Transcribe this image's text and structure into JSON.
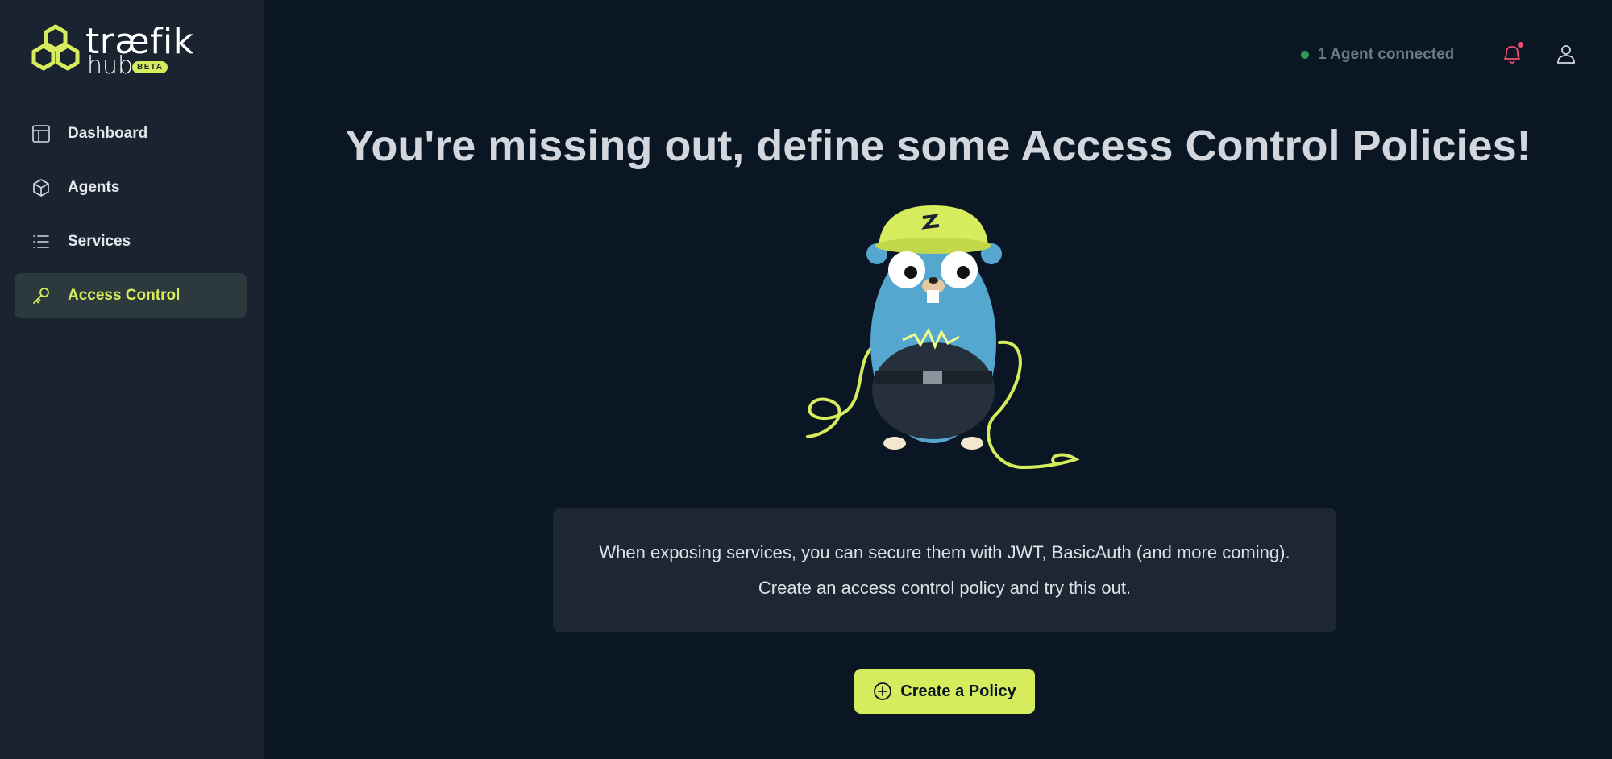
{
  "brand": {
    "name": "træfik",
    "product": "hub",
    "badge": "BETA",
    "accent_color": "#d6ec5c"
  },
  "sidebar": {
    "items": [
      {
        "label": "Dashboard",
        "icon": "layout-icon",
        "active": false
      },
      {
        "label": "Agents",
        "icon": "box-icon",
        "active": false
      },
      {
        "label": "Services",
        "icon": "list-icon",
        "active": false
      },
      {
        "label": "Access Control",
        "icon": "key-icon",
        "active": true
      }
    ]
  },
  "topbar": {
    "status_text": "1 Agent connected",
    "status_color": "#2f9c55",
    "notification_icon": "bell-icon",
    "has_unread": true,
    "user_icon": "user-icon"
  },
  "main": {
    "headline": "You're missing out, define some Access Control Policies!",
    "illustration": "gopher-with-cables",
    "info_line1": "When exposing services, you can secure them with JWT, BasicAuth (and more coming).",
    "info_line2": "Create an access control policy and try this out.",
    "cta_label": "Create a Policy",
    "cta_icon": "plus-circle-icon"
  }
}
